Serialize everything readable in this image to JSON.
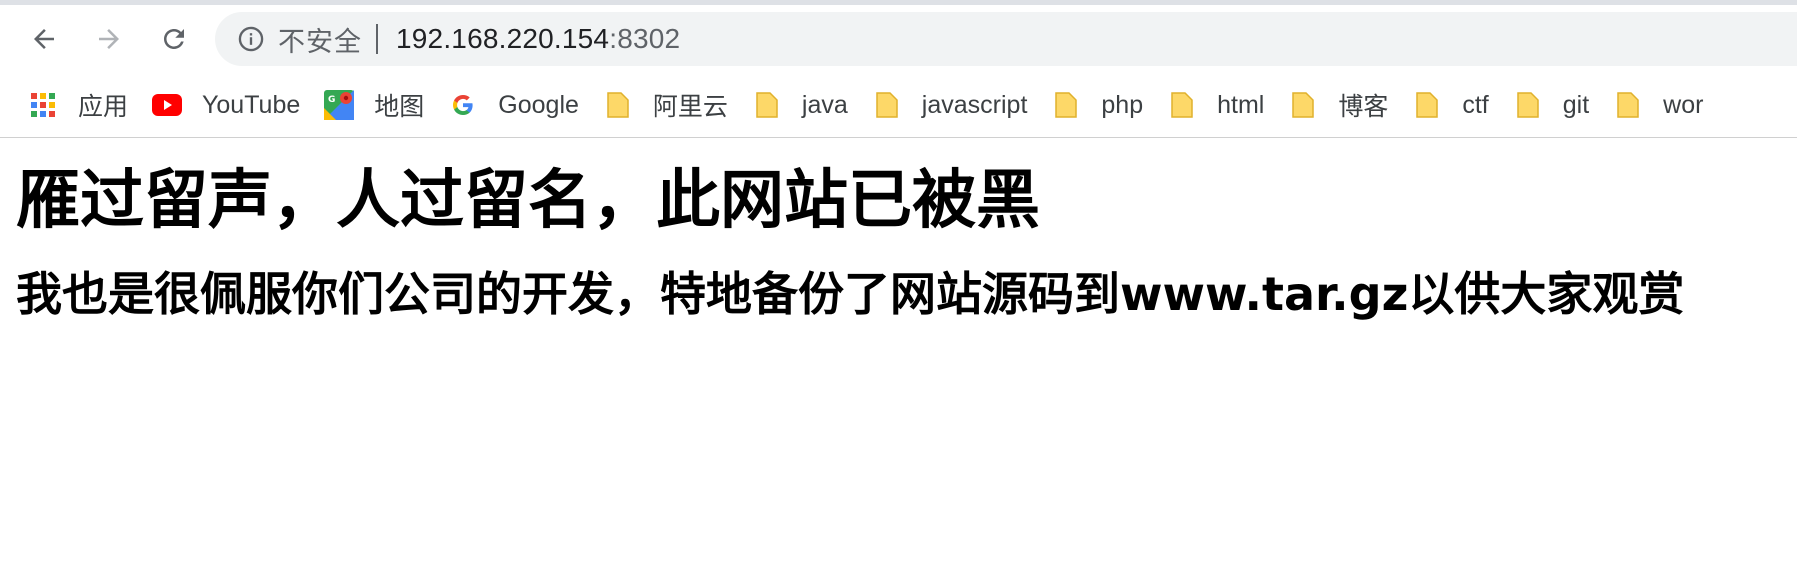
{
  "browser": {
    "nav": {
      "back_icon": "arrow-left-icon",
      "forward_icon": "arrow-right-icon",
      "reload_icon": "reload-icon"
    },
    "omnibox": {
      "security_icon": "info-circle-icon",
      "security_label": "不安全",
      "url_host": "192.168.220.154",
      "url_port": ":8302"
    },
    "bookmarks": [
      {
        "label": "应用",
        "icon": "apps-grid-icon"
      },
      {
        "label": "YouTube",
        "icon": "youtube-icon"
      },
      {
        "label": "地图",
        "icon": "maps-icon"
      },
      {
        "label": "Google",
        "icon": "google-icon"
      },
      {
        "label": "阿里云",
        "icon": "folder-icon"
      },
      {
        "label": "java",
        "icon": "folder-icon"
      },
      {
        "label": "javascript",
        "icon": "folder-icon"
      },
      {
        "label": "php",
        "icon": "folder-icon"
      },
      {
        "label": "html",
        "icon": "folder-icon"
      },
      {
        "label": "博客",
        "icon": "folder-icon"
      },
      {
        "label": "ctf",
        "icon": "folder-icon"
      },
      {
        "label": "git",
        "icon": "folder-icon"
      },
      {
        "label": "wor",
        "icon": "folder-icon"
      }
    ]
  },
  "page": {
    "heading": "雁过留声，人过留名，此网站已被黑",
    "subheading": "我也是很佩服你们公司的开发，特地备份了网站源码到www.tar.gz以供大家观赏"
  },
  "colors": {
    "toolbar_bg": "#ffffff",
    "omnibox_bg": "#f1f3f4",
    "icon_gray": "#5f6368",
    "folder_yellow": "#fcd663",
    "youtube_red": "#ff0000"
  }
}
